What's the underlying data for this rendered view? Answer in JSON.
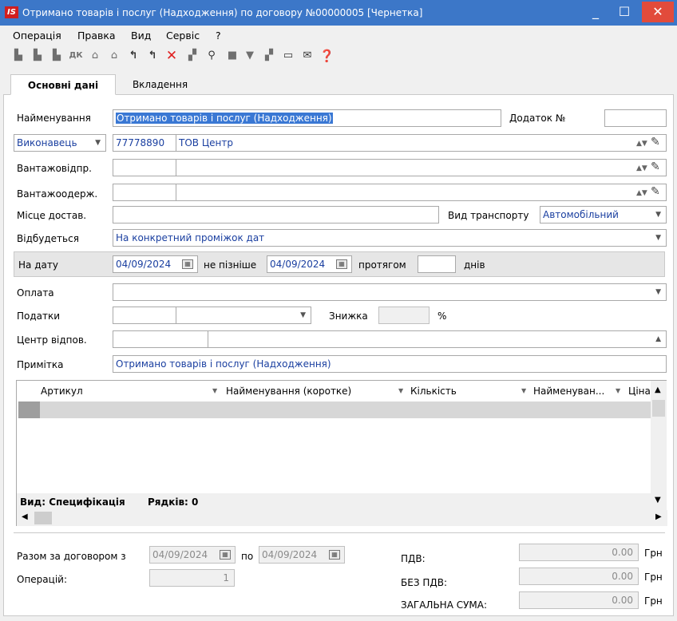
{
  "window": {
    "logo": "IS",
    "title": "Отримано товарів і послуг (Надходження) по договору №00000005 [Чернетка]",
    "minimize": "_",
    "maximize": "☐",
    "close": "✕"
  },
  "menu": [
    "Операція",
    "Правка",
    "Вид",
    "Сервіс",
    "?"
  ],
  "tabs": {
    "main": "Основні дані",
    "attachments": "Вкладення"
  },
  "form": {
    "name_label": "Найменування",
    "name_value": "Отримано товарів і послуг (Надходження)",
    "appendix_label": "Додаток №",
    "appendix_value": "",
    "executor_label": "Виконавець",
    "executor_code": "77778890",
    "executor_name": "ТОВ Центр",
    "shipper_label": "Вантажовідпр.",
    "consignee_label": "Вантажоодерж.",
    "delivery_place_label": "Місце достав.",
    "transport_label": "Вид транспорту",
    "transport_value": "Автомобільний",
    "takes_place_label": "Відбудеться",
    "takes_place_value": "На конкретний проміжок дат",
    "on_date_label": "На дату",
    "on_date_value": "04/09/2024",
    "not_later_label": "не пізніше",
    "not_later_value": "04/09/2024",
    "during_label": "протягом",
    "during_value": "",
    "days_label": "днів",
    "payment_label": "Оплата",
    "taxes_label": "Податки",
    "discount_label": "Знижка",
    "discount_unit": "%",
    "resp_center_label": "Центр відпов.",
    "note_label": "Примітка",
    "note_value": "Отримано товарів і послуг (Надходження)"
  },
  "grid": {
    "columns": [
      "Артикул",
      "Найменування (коротке)",
      "Кількість",
      "Найменуван...",
      "Ціна"
    ],
    "footer_view": "Вид: Специфікація",
    "footer_rows": "Рядків: 0"
  },
  "summary": {
    "total_label": "Разом за договором з",
    "from_date": "04/09/2024",
    "to_label": "по",
    "to_date": "04/09/2024",
    "operations_label": "Операцій:",
    "operations_value": "1",
    "vat_label": "ПДВ:",
    "vat_value": "0.00",
    "no_vat_label": "БЕЗ ПДВ:",
    "no_vat_value": "0.00",
    "total_sum_label": "ЗАГАЛЬНА СУМА:",
    "total_sum_value": "0.00",
    "currency": "Грн"
  }
}
